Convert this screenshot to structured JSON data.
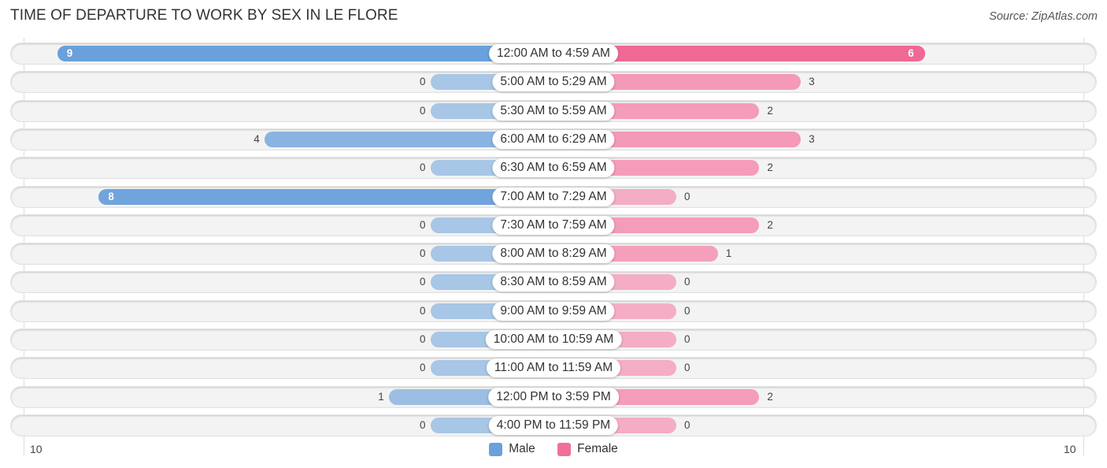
{
  "chart_data": {
    "type": "bar",
    "orientation": "horizontal-diverging",
    "title": "TIME OF DEPARTURE TO WORK BY SEX IN LE FLORE",
    "source": "Source: ZipAtlas.com",
    "categories": [
      "12:00 AM to 4:59 AM",
      "5:00 AM to 5:29 AM",
      "5:30 AM to 5:59 AM",
      "6:00 AM to 6:29 AM",
      "6:30 AM to 6:59 AM",
      "7:00 AM to 7:29 AM",
      "7:30 AM to 7:59 AM",
      "8:00 AM to 8:29 AM",
      "8:30 AM to 8:59 AM",
      "9:00 AM to 9:59 AM",
      "10:00 AM to 10:59 AM",
      "11:00 AM to 11:59 AM",
      "12:00 PM to 3:59 PM",
      "4:00 PM to 11:59 PM"
    ],
    "series": [
      {
        "name": "Male",
        "color": "#6aa0db",
        "values": [
          9,
          0,
          0,
          4,
          0,
          8,
          0,
          0,
          0,
          0,
          0,
          0,
          1,
          0
        ]
      },
      {
        "name": "Female",
        "color": "#f07098",
        "values": [
          6,
          3,
          2,
          3,
          2,
          0,
          2,
          1,
          0,
          0,
          0,
          0,
          2,
          0
        ]
      }
    ],
    "axis": {
      "min_label": "10",
      "max_label": "10",
      "range": [
        10,
        10
      ]
    },
    "legend": {
      "position": "bottom-center",
      "entries": [
        "Male",
        "Female"
      ]
    },
    "grid": false
  }
}
